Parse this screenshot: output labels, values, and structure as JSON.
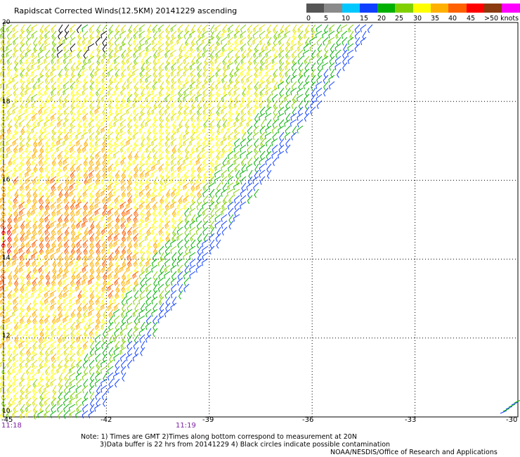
{
  "title": "Rapidscat Corrected Winds(12.5KM) 20141229 ascending",
  "colorbar": {
    "labels": [
      "0",
      "5",
      "10",
      "15",
      "20",
      "25",
      "30",
      "35",
      "40",
      "45",
      ">50 knots"
    ],
    "colors": [
      "#555555",
      "#8a8a8a",
      "#00c8ff",
      "#1040ff",
      "#00b000",
      "#80d000",
      "#ffff00",
      "#ffb000",
      "#ff6000",
      "#ff0000",
      "#8b3a10",
      "#ff00ff",
      "#5a0080"
    ]
  },
  "map": {
    "lon_ticks": [
      "-45",
      "-42",
      "-39",
      "-36",
      "-33",
      "-30"
    ],
    "lat_ticks": [
      "20",
      "18",
      "16",
      "14",
      "12",
      "10"
    ],
    "times": [
      "11:18",
      "11:19"
    ]
  },
  "notes": {
    "line1": "Note: 1) Times are GMT 2)Times along bottom correspond to measurement at 20N",
    "line2": "3)Data buffer is 22 hrs from 20141229 4) Black circles indicate possible contamination",
    "line3": "NOAA/NESDIS/Office of Research and Applications"
  }
}
